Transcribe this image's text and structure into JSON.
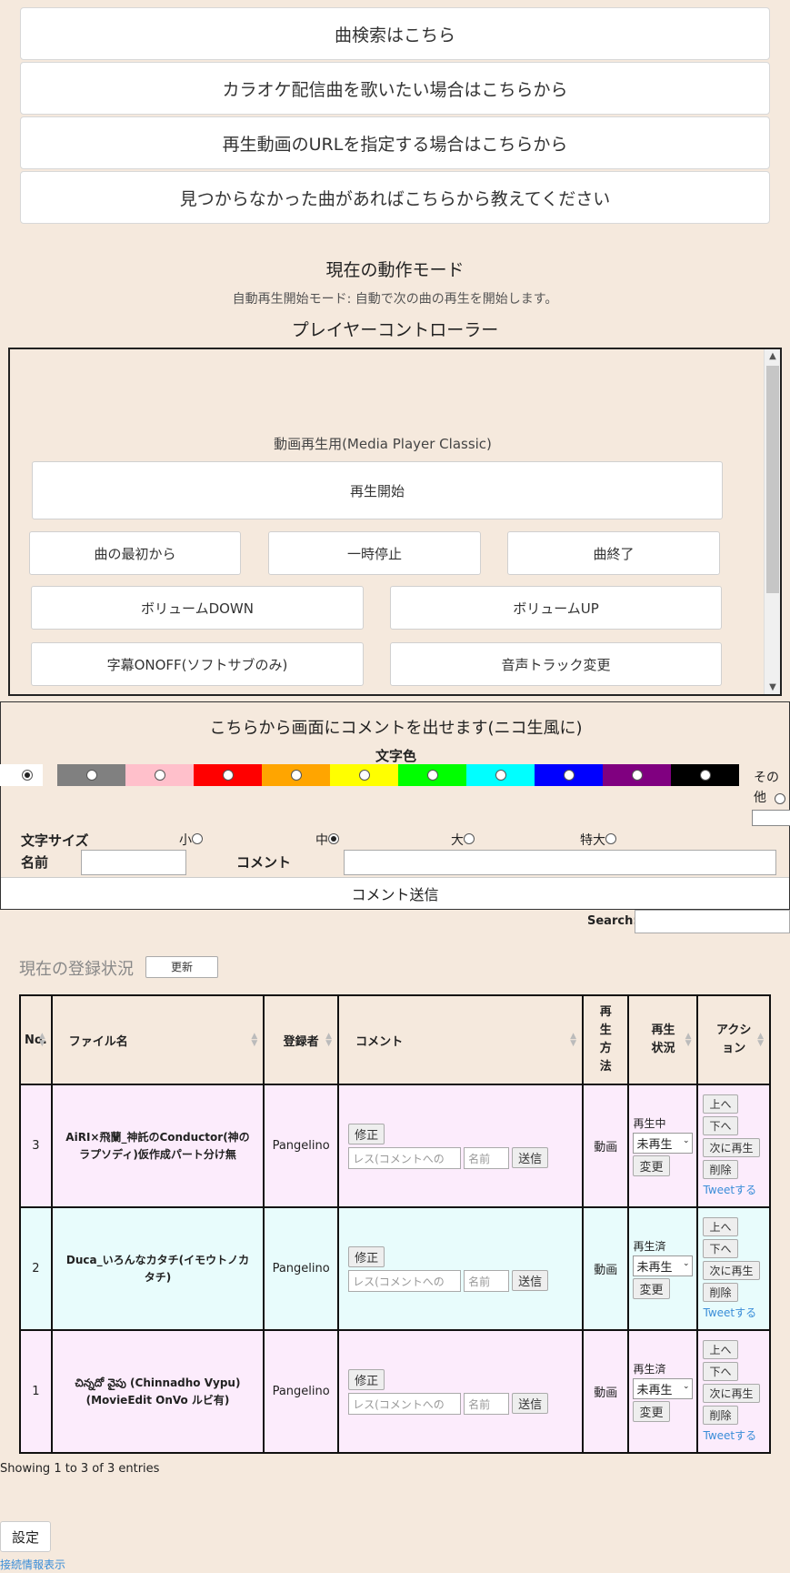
{
  "top_buttons": [
    "曲検索はこちら",
    "カラオケ配信曲を歌いたい場合はこちらから",
    "再生動画のURLを指定する場合はこちらから",
    "見つからなかった曲があればこちらから教えてください"
  ],
  "mode": {
    "title": "現在の動作モード",
    "description": "自動再生開始モード: 自動で次の曲の再生を開始します。",
    "controller_title": "プレイヤーコントローラー"
  },
  "player": {
    "label": "動画再生用(Media Player Classic)",
    "play": "再生開始",
    "from_start": "曲の最初から",
    "pause": "一時停止",
    "end": "曲終了",
    "vol_down": "ボリュームDOWN",
    "vol_up": "ボリュームUP",
    "subtitle": "字幕ONOFF(ソフトサブのみ)",
    "audio_track": "音声トラック変更"
  },
  "comment": {
    "title": "こちらから画面にコメントを出せます(ニコ生風に)",
    "color_label": "文字色",
    "colors": [
      "#ffffff",
      "#808080",
      "#ffc0cb",
      "#ff0000",
      "#ffa500",
      "#ffff00",
      "#00ff00",
      "#00ffff",
      "#0000ff",
      "#800080",
      "#000000"
    ],
    "selected_color": 0,
    "other_label": "その他",
    "size_label": "文字サイズ",
    "sizes": [
      "小",
      "中",
      "大",
      "特大"
    ],
    "selected_size": 1,
    "name_label": "名前",
    "comment_label": "コメント",
    "submit": "コメント送信"
  },
  "search_label": "Search:",
  "status": {
    "title": "現在の登録状況",
    "refresh": "更新"
  },
  "table": {
    "headers": [
      "No.",
      "ファイル名",
      "登録者",
      "コメント",
      "再生方法",
      "再生状況",
      "アクション"
    ],
    "rows": [
      {
        "no": "3",
        "file": "AiRI×飛蘭_神託のConductor(神のラプソディ)仮作成パート分け無",
        "user": "Pangelino",
        "method": "動画",
        "state": "再生中",
        "select": "未再生"
      },
      {
        "no": "2",
        "file": "Duca_いろんなカタチ(イモウトノカタチ)",
        "user": "Pangelino",
        "method": "動画",
        "state": "再生済",
        "select": "未再生"
      },
      {
        "no": "1",
        "file": "చిన్నదో వైపు (Chinnadho Vypu)(MovieEdit OnVo ルビ有)",
        "user": "Pangelino",
        "method": "動画",
        "state": "再生済",
        "select": "未再生"
      }
    ],
    "edit": "修正",
    "reply_placeholder": "レス(コメントへの",
    "name_placeholder": "名前",
    "send": "送信",
    "change": "変更",
    "up": "上へ",
    "down": "下へ",
    "next": "次に再生",
    "delete": "削除",
    "tweet": "Tweetする"
  },
  "showing": "Showing 1 to 3 of 3 entries",
  "settings": "設定",
  "connection": "接続情報表示"
}
